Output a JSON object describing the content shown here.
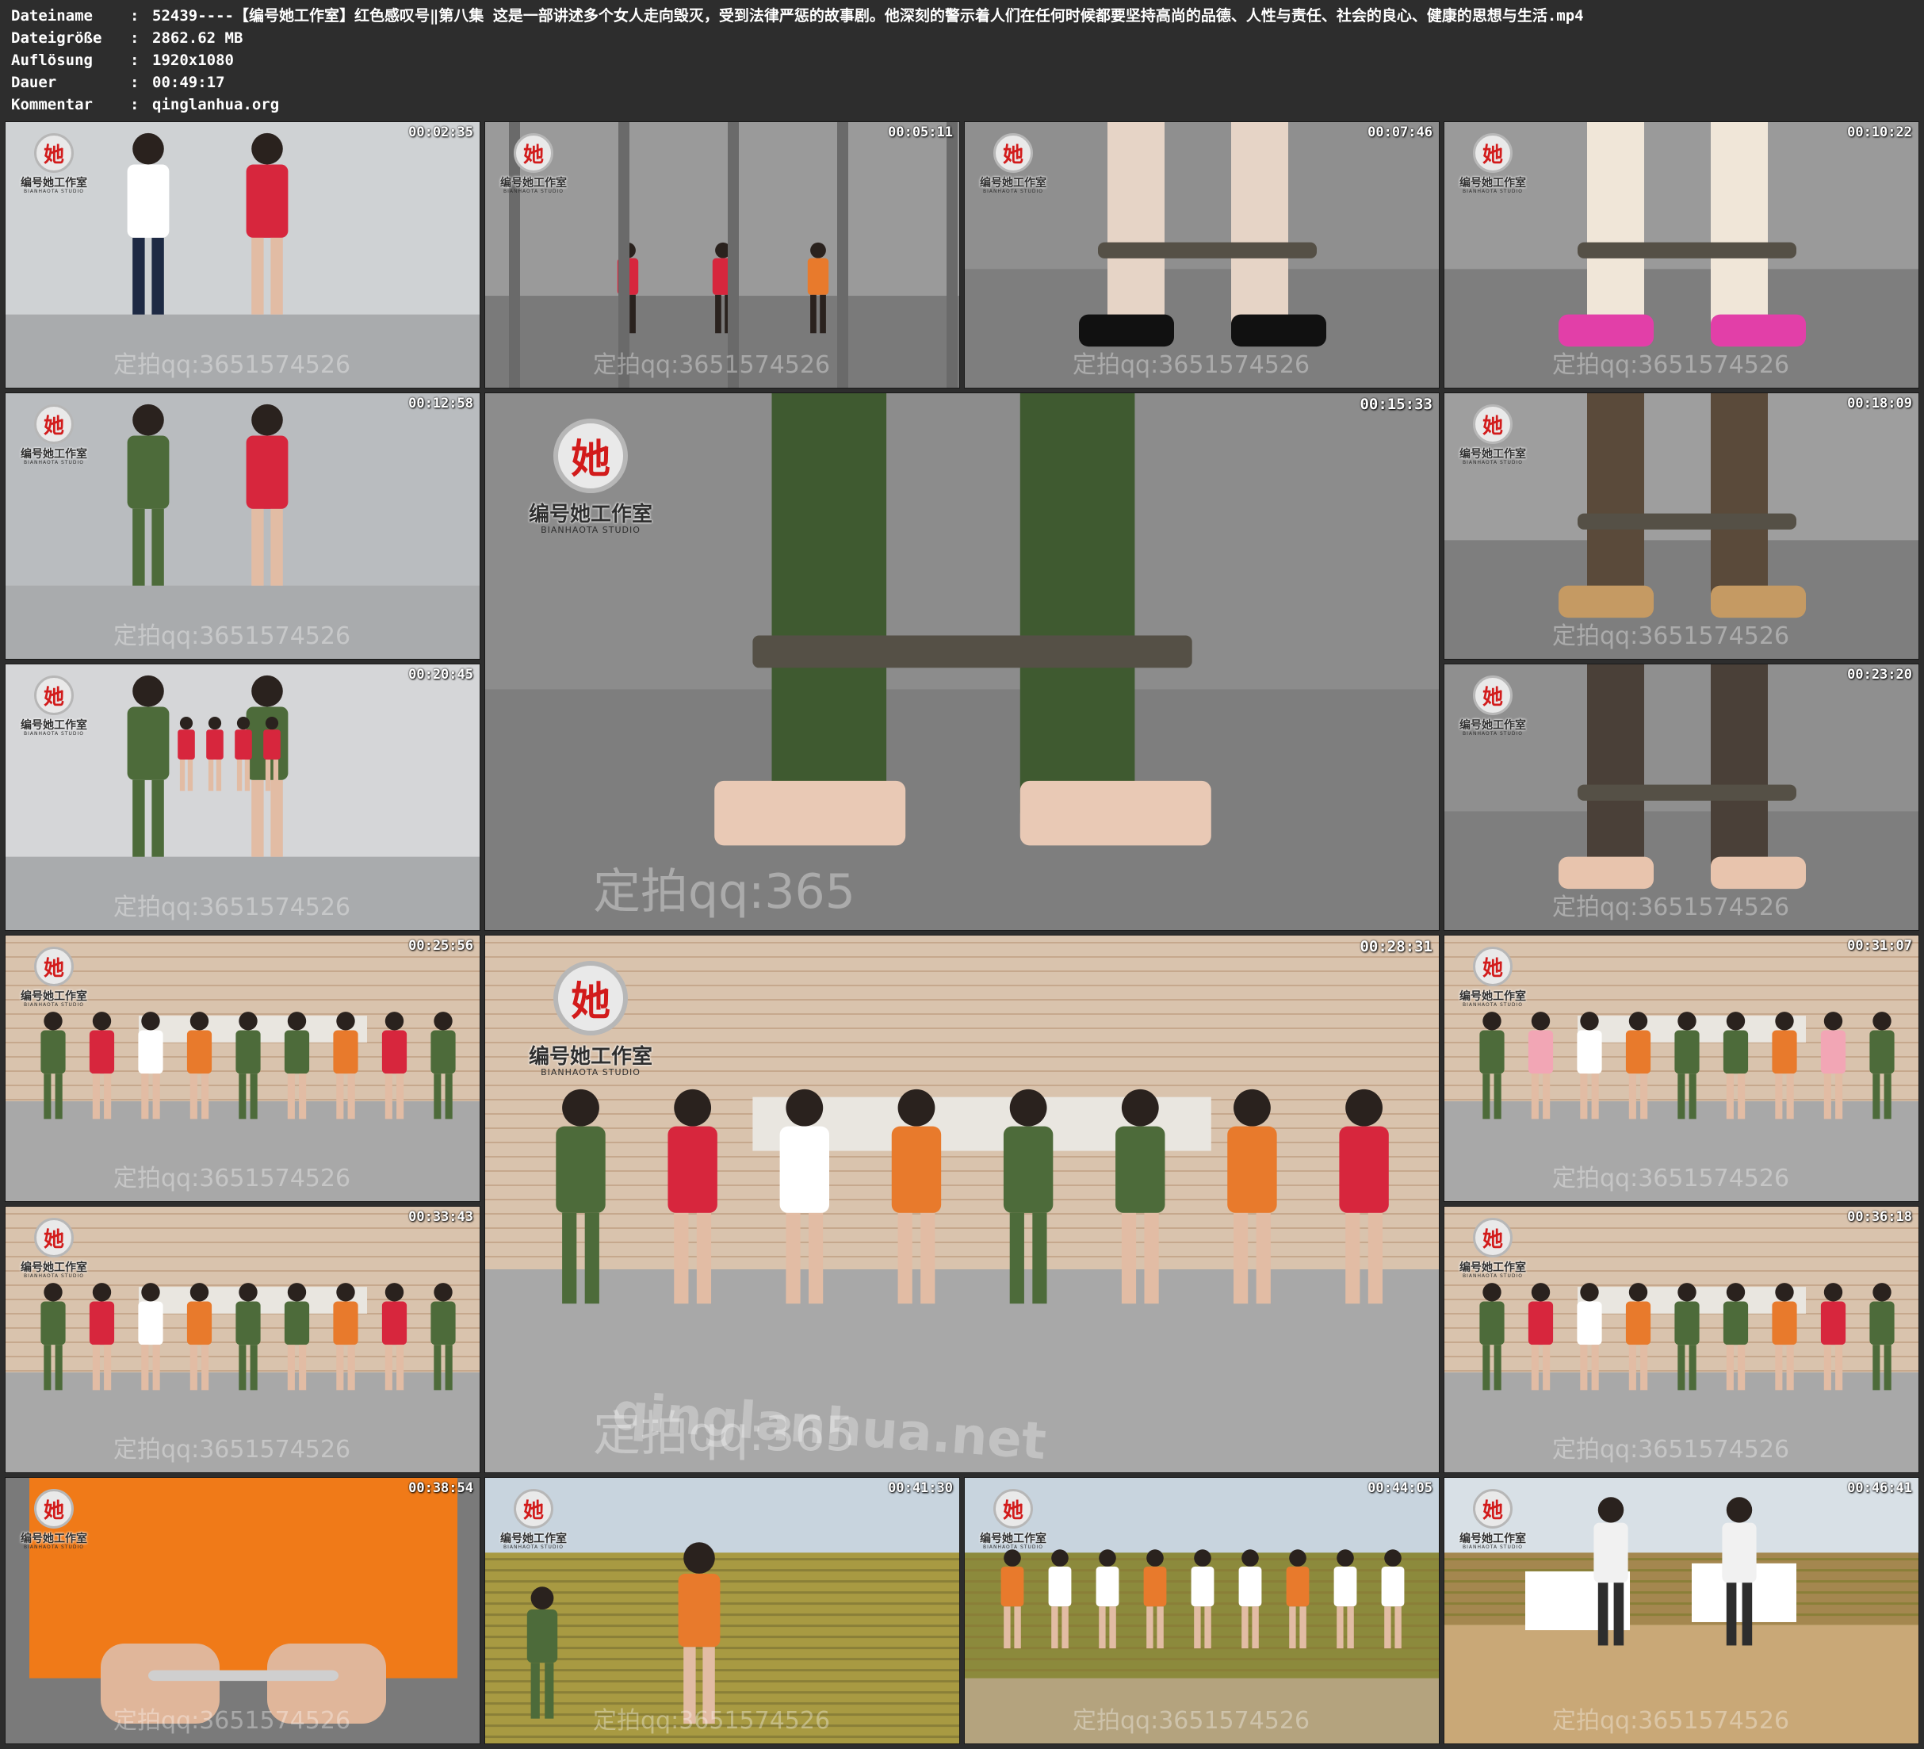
{
  "file_info": {
    "rows": [
      {
        "key": "Dateiname",
        "value": "52439----【编号她工作室】红色感叹号‖第八集 这是一部讲述多个女人走向毁灭，受到法律严惩的故事剧。他深刻的警示着人们在任何时候都要坚持高尚的品德、人性与责任、社会的良心、健康的思想与生活.mp4"
      },
      {
        "key": "Dateigröße",
        "value": "2862.62 MB"
      },
      {
        "key": "Auflösung",
        "value": "1920x1080"
      },
      {
        "key": "Dauer",
        "value": "00:49:17"
      },
      {
        "key": "Kommentar",
        "value": "qinglanhua.org"
      }
    ],
    "separator": ":"
  },
  "logo": {
    "glyph": "她",
    "brand": "编号她工作室",
    "sub": "BIANHAOTA STUDIO",
    "accent": "#d21b1b"
  },
  "watermarks": {
    "contact_full": "定拍qq:3651574526",
    "contact_short": "定拍qq:365",
    "contact_tail": "1574526",
    "site": "qinglanhua.net",
    "site_alt": "qinglanhua.org"
  },
  "thumbnails": [
    {
      "time": "00:02:35",
      "scene": "corridor-handcuffing",
      "colors": [
        "#cfd2d4",
        "#ffffff",
        "#d7263d"
      ]
    },
    {
      "time": "00:05:11",
      "scene": "cell-bars-kneeling",
      "colors": [
        "#9a9a9a",
        "#7a7a7a",
        "#e87a2c"
      ]
    },
    {
      "time": "00:07:46",
      "scene": "shoes-closeup",
      "colors": [
        "#8f8f8f",
        "#111111",
        "#e6d4c6"
      ]
    },
    {
      "time": "00:10:22",
      "scene": "shackled-heels",
      "colors": [
        "#9a9a9a",
        "#e23fa8",
        "#f0e6d8"
      ]
    },
    {
      "time": "00:12:58",
      "scene": "soldiers-in-cell",
      "colors": [
        "#b9bcbf",
        "#4d6b3a",
        "#d7263d"
      ]
    },
    {
      "time": "00:15:33",
      "scene": "ankle-shackles-closeup",
      "colors": [
        "#8c8c8c",
        "#e9c9b5",
        "#3f5a30"
      ]
    },
    {
      "time": "00:18:09",
      "scene": "leopard-sandals-chains",
      "colors": [
        "#9e9e9e",
        "#c59a63",
        "#5a4a3a"
      ]
    },
    {
      "time": "00:20:45",
      "scene": "corridor-line",
      "colors": [
        "#d5d6d8",
        "#4d6b3a",
        "#d7263d"
      ]
    },
    {
      "time": "00:23:20",
      "scene": "nude-heels-shackles",
      "colors": [
        "#8f8f8f",
        "#e8c4ad",
        "#4a4038"
      ]
    },
    {
      "time": "00:25:56",
      "scene": "tribunal-lineup",
      "colors": [
        "#d9c3ad",
        "#e87a2c",
        "#d7263d"
      ]
    },
    {
      "time": "00:28:31",
      "scene": "tribunal-lineup-main",
      "colors": [
        "#d9c3ad",
        "#e87a2c",
        "#d7263d"
      ]
    },
    {
      "time": "00:31:07",
      "scene": "tribunal-lineup",
      "colors": [
        "#d9c3ad",
        "#e87a2c",
        "#f2a6b5"
      ]
    },
    {
      "time": "00:33:43",
      "scene": "tribunal-lineup",
      "colors": [
        "#d9c3ad",
        "#e87a2c",
        "#d7263d"
      ]
    },
    {
      "time": "00:36:18",
      "scene": "tribunal-lineup",
      "colors": [
        "#d9c3ad",
        "#e87a2c",
        "#d7263d"
      ]
    },
    {
      "time": "00:38:54",
      "scene": "cuffed-hands-closeup",
      "colors": [
        "#7a7a7a",
        "#f07a18",
        "#e0b69a"
      ]
    },
    {
      "time": "00:41:30",
      "scene": "field-escort",
      "colors": [
        "#c8d4de",
        "#a89a42",
        "#e87a2c"
      ]
    },
    {
      "time": "00:44:05",
      "scene": "field-lineup",
      "colors": [
        "#c8d4de",
        "#8c8a3c",
        "#e87a2c"
      ]
    },
    {
      "time": "00:46:41",
      "scene": "field-ground",
      "colors": [
        "#d8e0e6",
        "#a4874f",
        "#ffffff"
      ]
    }
  ]
}
